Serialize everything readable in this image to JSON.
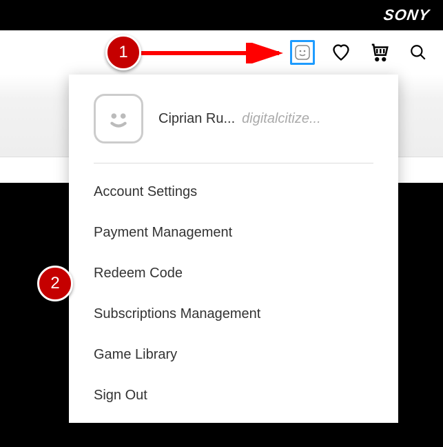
{
  "brand": {
    "name": "SONY"
  },
  "header": {
    "icons": [
      "profile-icon",
      "heart-icon",
      "cart-icon",
      "search-icon"
    ]
  },
  "dropdown": {
    "display_name": "Ciprian Ru...",
    "handle": "digitalcitize...",
    "menu": [
      "Account Settings",
      "Payment Management",
      "Redeem Code",
      "Subscriptions Management",
      "Game Library",
      "Sign Out"
    ]
  },
  "annotations": {
    "badge1": "1",
    "badge2": "2"
  }
}
